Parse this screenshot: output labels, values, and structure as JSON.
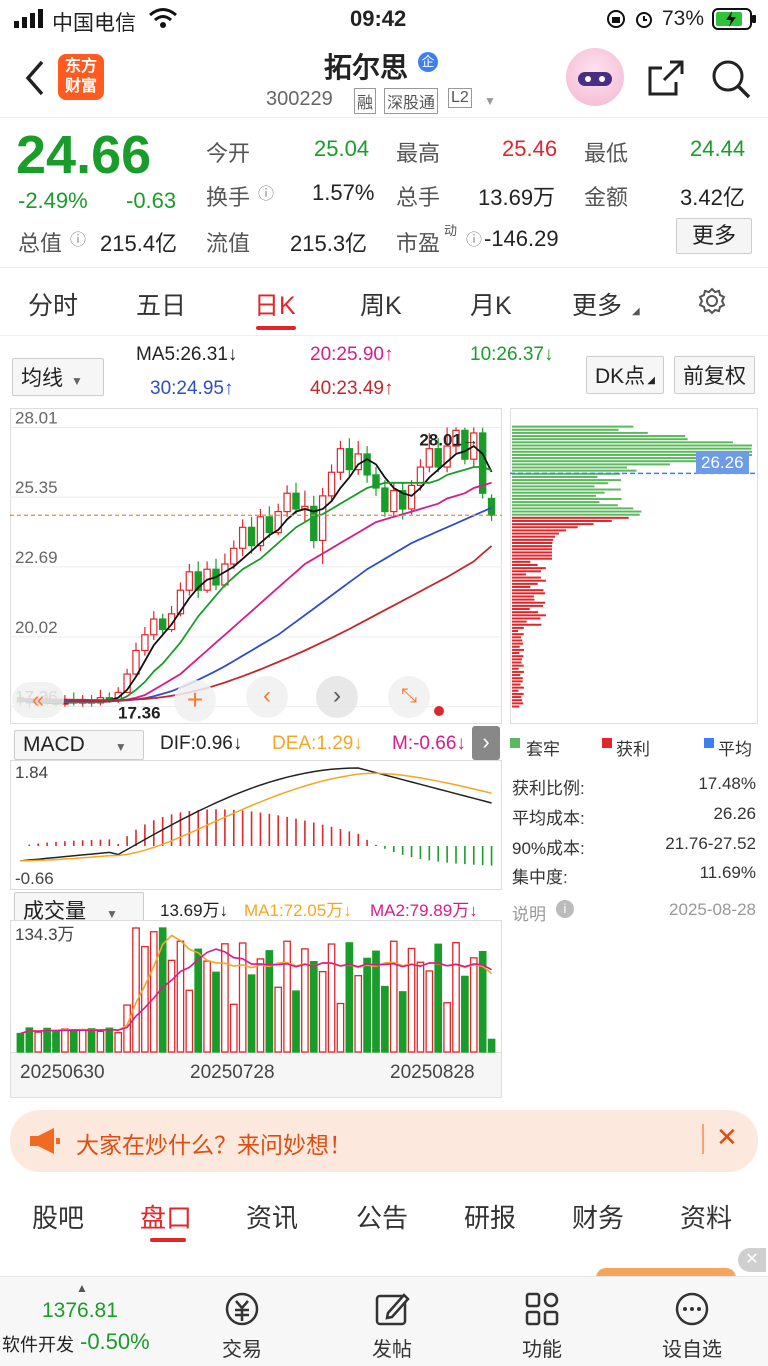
{
  "status": {
    "carrier": "中国电信",
    "time": "09:42",
    "battery": "73%"
  },
  "header": {
    "app_logo": "东方\n财富",
    "title": "拓尔思",
    "badge": "企",
    "code": "300229",
    "tags": [
      "融",
      "深股通",
      "L2"
    ]
  },
  "quote": {
    "price": "24.66",
    "pct": "-2.49%",
    "chg": "-0.63",
    "mktcap_label": "总值",
    "mktcap": "215.4亿",
    "fields": [
      {
        "label": "今开",
        "value": "25.04",
        "color": "green"
      },
      {
        "label": "最高",
        "value": "25.46",
        "color": "red"
      },
      {
        "label": "最低",
        "value": "24.44",
        "color": "green"
      },
      {
        "label": "换手",
        "value": "1.57%",
        "color": "black"
      },
      {
        "label": "总手",
        "value": "13.69万",
        "color": "black"
      },
      {
        "label": "金额",
        "value": "3.42亿",
        "color": "black"
      },
      {
        "label": "流值",
        "value": "215.3亿",
        "color": "black"
      },
      {
        "label": "市盈",
        "sup": "动",
        "value": "-146.29",
        "color": "black"
      }
    ],
    "more_label": "更多"
  },
  "chart_tabs": [
    "分时",
    "五日",
    "日K",
    "周K",
    "月K",
    "更多"
  ],
  "active_tab": "日K",
  "kline_controls": {
    "ma_select": "均线",
    "ma5": "MA5:26.31↓",
    "ma10": "10:26.37↓",
    "ma20": "20:25.90↑",
    "ma30": "30:24.95↑",
    "ma40": "40:23.49↑",
    "dk_label": "DK点",
    "adj_label": "前复权"
  },
  "chart_data": [
    {
      "type": "candlestick",
      "title": "日K",
      "y_ticks": [
        "28.01",
        "25.35",
        "22.69",
        "20.02",
        "17.36"
      ],
      "ylim": [
        17.0,
        28.6
      ],
      "high_annotation": "28.01→",
      "low_annotation": "17.36",
      "last_ma_line": "26.26",
      "candles": [
        [
          17.7,
          17.6,
          17.9,
          17.4
        ],
        [
          17.6,
          17.5,
          17.8,
          17.3
        ],
        [
          17.5,
          17.55,
          17.8,
          17.36
        ],
        [
          17.55,
          17.5,
          17.8,
          17.4
        ],
        [
          17.5,
          17.45,
          17.7,
          17.36
        ],
        [
          17.45,
          17.6,
          17.8,
          17.36
        ],
        [
          17.6,
          17.5,
          17.9,
          17.4
        ],
        [
          17.5,
          17.55,
          17.8,
          17.36
        ],
        [
          17.55,
          17.5,
          17.8,
          17.36
        ],
        [
          17.5,
          17.7,
          18.0,
          17.4
        ],
        [
          17.7,
          17.6,
          17.9,
          17.5
        ],
        [
          17.6,
          17.9,
          18.1,
          17.5
        ],
        [
          17.9,
          18.6,
          18.8,
          17.9
        ],
        [
          18.6,
          19.5,
          19.8,
          18.5
        ],
        [
          19.5,
          20.1,
          20.4,
          19.3
        ],
        [
          20.1,
          20.7,
          21.0,
          19.9
        ],
        [
          20.7,
          20.3,
          20.9,
          20.1
        ],
        [
          20.3,
          20.9,
          21.2,
          20.2
        ],
        [
          20.9,
          21.8,
          22.1,
          20.8
        ],
        [
          21.8,
          22.5,
          22.8,
          21.6
        ],
        [
          22.5,
          21.8,
          22.9,
          21.5
        ],
        [
          21.8,
          22.6,
          22.9,
          21.7
        ],
        [
          22.6,
          22.0,
          23.0,
          21.8
        ],
        [
          22.0,
          22.8,
          23.2,
          21.9
        ],
        [
          22.8,
          23.4,
          23.7,
          22.6
        ],
        [
          23.4,
          24.2,
          24.5,
          23.1
        ],
        [
          24.2,
          23.5,
          24.6,
          23.2
        ],
        [
          23.5,
          24.6,
          24.9,
          23.3
        ],
        [
          24.6,
          24.0,
          25.0,
          23.8
        ],
        [
          24.0,
          24.8,
          25.1,
          23.9
        ],
        [
          24.8,
          25.5,
          25.8,
          24.6
        ],
        [
          25.5,
          24.9,
          25.9,
          24.7
        ],
        [
          24.9,
          25.0,
          25.6,
          24.4
        ],
        [
          25.0,
          23.7,
          25.4,
          23.4
        ],
        [
          23.7,
          25.4,
          25.7,
          22.8
        ],
        [
          25.4,
          26.3,
          26.6,
          25.2
        ],
        [
          26.3,
          27.2,
          27.5,
          26.0
        ],
        [
          27.2,
          26.4,
          27.6,
          26.1
        ],
        [
          26.4,
          27.0,
          27.5,
          26.2
        ],
        [
          27.0,
          26.2,
          27.3,
          25.9
        ],
        [
          26.2,
          25.7,
          26.5,
          25.4
        ],
        [
          25.7,
          24.8,
          26.0,
          24.6
        ],
        [
          24.8,
          25.6,
          25.9,
          24.6
        ],
        [
          25.6,
          24.9,
          25.9,
          24.5
        ],
        [
          24.9,
          25.8,
          26.0,
          24.7
        ],
        [
          25.8,
          26.5,
          26.8,
          25.6
        ],
        [
          26.5,
          27.2,
          27.8,
          26.3
        ],
        [
          27.2,
          26.5,
          27.6,
          26.3
        ],
        [
          26.5,
          27.3,
          28.01,
          26.3
        ],
        [
          27.3,
          27.9,
          28.01,
          27.0
        ],
        [
          27.9,
          26.8,
          28.0,
          26.6
        ],
        [
          26.8,
          27.8,
          28.01,
          26.5
        ],
        [
          27.8,
          25.5,
          28.0,
          25.3
        ],
        [
          25.3,
          24.66,
          25.46,
          24.44
        ]
      ],
      "series": [
        {
          "name": "MA5",
          "values": [
            17.6,
            17.55,
            17.52,
            17.5,
            17.49,
            17.5,
            17.52,
            17.54,
            17.55,
            17.57,
            17.6,
            17.7,
            18.0,
            18.5,
            19.1,
            19.7,
            20.1,
            20.5,
            21.0,
            21.5,
            21.9,
            22.2,
            22.3,
            22.5,
            22.7,
            23.0,
            23.3,
            23.6,
            23.9,
            24.1,
            24.5,
            24.8,
            24.9,
            24.8,
            24.9,
            25.2,
            25.7,
            26.1,
            26.6,
            26.8,
            26.6,
            26.1,
            25.7,
            25.5,
            25.4,
            25.7,
            26.1,
            26.4,
            26.7,
            27.0,
            27.1,
            27.3,
            27.0,
            26.31
          ]
        },
        {
          "name": "MA10",
          "values": [
            17.6,
            17.58,
            17.56,
            17.54,
            17.52,
            17.52,
            17.52,
            17.52,
            17.52,
            17.53,
            17.55,
            17.6,
            17.75,
            18.0,
            18.3,
            18.7,
            19.0,
            19.4,
            19.8,
            20.3,
            20.8,
            21.2,
            21.6,
            22.0,
            22.3,
            22.6,
            22.8,
            23.0,
            23.3,
            23.6,
            23.9,
            24.2,
            24.4,
            24.6,
            24.7,
            24.9,
            25.1,
            25.3,
            25.5,
            25.7,
            25.8,
            25.9,
            25.9,
            25.9,
            25.9,
            25.9,
            25.9,
            26.0,
            26.2,
            26.3,
            26.4,
            26.5,
            26.5,
            26.37
          ]
        },
        {
          "name": "MA20",
          "values": [
            17.6,
            17.6,
            17.58,
            17.57,
            17.56,
            17.55,
            17.55,
            17.55,
            17.55,
            17.55,
            17.56,
            17.58,
            17.63,
            17.7,
            17.8,
            18.0,
            18.2,
            18.4,
            18.6,
            18.9,
            19.2,
            19.5,
            19.8,
            20.1,
            20.4,
            20.7,
            21.0,
            21.3,
            21.6,
            21.9,
            22.2,
            22.5,
            22.8,
            23.0,
            23.2,
            23.4,
            23.6,
            23.8,
            24.0,
            24.2,
            24.4,
            24.5,
            24.6,
            24.7,
            24.8,
            24.9,
            25.0,
            25.1,
            25.3,
            25.4,
            25.5,
            25.7,
            25.8,
            25.9
          ]
        },
        {
          "name": "MA30",
          "values": [
            17.62,
            17.62,
            17.61,
            17.6,
            17.59,
            17.58,
            17.58,
            17.57,
            17.57,
            17.57,
            17.57,
            17.58,
            17.6,
            17.63,
            17.68,
            17.75,
            17.85,
            17.95,
            18.08,
            18.22,
            18.38,
            18.55,
            18.72,
            18.9,
            19.1,
            19.3,
            19.5,
            19.7,
            19.9,
            20.1,
            20.35,
            20.6,
            20.85,
            21.1,
            21.35,
            21.6,
            21.85,
            22.1,
            22.35,
            22.6,
            22.8,
            23.0,
            23.2,
            23.4,
            23.6,
            23.75,
            23.9,
            24.05,
            24.2,
            24.35,
            24.5,
            24.65,
            24.8,
            24.95
          ]
        },
        {
          "name": "MA40",
          "values": [
            17.65,
            17.65,
            17.64,
            17.64,
            17.63,
            17.63,
            17.62,
            17.62,
            17.61,
            17.61,
            17.61,
            17.61,
            17.62,
            17.63,
            17.65,
            17.68,
            17.72,
            17.77,
            17.83,
            17.9,
            17.98,
            18.07,
            18.17,
            18.28,
            18.4,
            18.52,
            18.65,
            18.78,
            18.92,
            19.06,
            19.2,
            19.35,
            19.5,
            19.66,
            19.82,
            19.98,
            20.15,
            20.32,
            20.5,
            20.68,
            20.86,
            21.04,
            21.22,
            21.4,
            21.58,
            21.76,
            21.94,
            22.12,
            22.3,
            22.5,
            22.7,
            22.9,
            23.2,
            23.49
          ]
        }
      ]
    },
    {
      "type": "bar",
      "title": "MACD",
      "indicator_select": "MACD",
      "dif": "DIF:0.96↓",
      "dea": "DEA:1.29↓",
      "m": "M:-0.66↓",
      "y_ticks": [
        "1.84",
        "-0.66"
      ]
    },
    {
      "type": "bar",
      "title": "成交量",
      "indicator_select": "成交量",
      "vol": "13.69万↓",
      "ma1": "MA1:72.05万↓",
      "ma2": "MA2:79.89万↓",
      "y_ticks": [
        "134.3万"
      ],
      "x_ticks": [
        "20250630",
        "20250728",
        "20250828"
      ]
    }
  ],
  "chip": {
    "current": "26.26",
    "legend": [
      "套牢",
      "获利",
      "平均"
    ],
    "rows": [
      {
        "label": "获利比例:",
        "value": "17.48%"
      },
      {
        "label": "平均成本:",
        "value": "26.26"
      },
      {
        "label": "90%成本:",
        "value": "21.76-27.52"
      },
      {
        "label": "集中度:",
        "value": "11.69%"
      }
    ],
    "note_label": "说明",
    "note_date": "2025-08-28"
  },
  "banner": {
    "text": "大家在炒什么？来问妙想！"
  },
  "bottom_tabs": [
    "股吧",
    "盘口",
    "资讯",
    "公告",
    "研报",
    "财务",
    "资料"
  ],
  "active_bottom_tab": "盘口",
  "dock": {
    "index_value": "1376.81",
    "index_label": "软件开发",
    "index_pct": "-0.50%",
    "items": [
      "交易",
      "发帖",
      "功能",
      "设自选"
    ]
  }
}
